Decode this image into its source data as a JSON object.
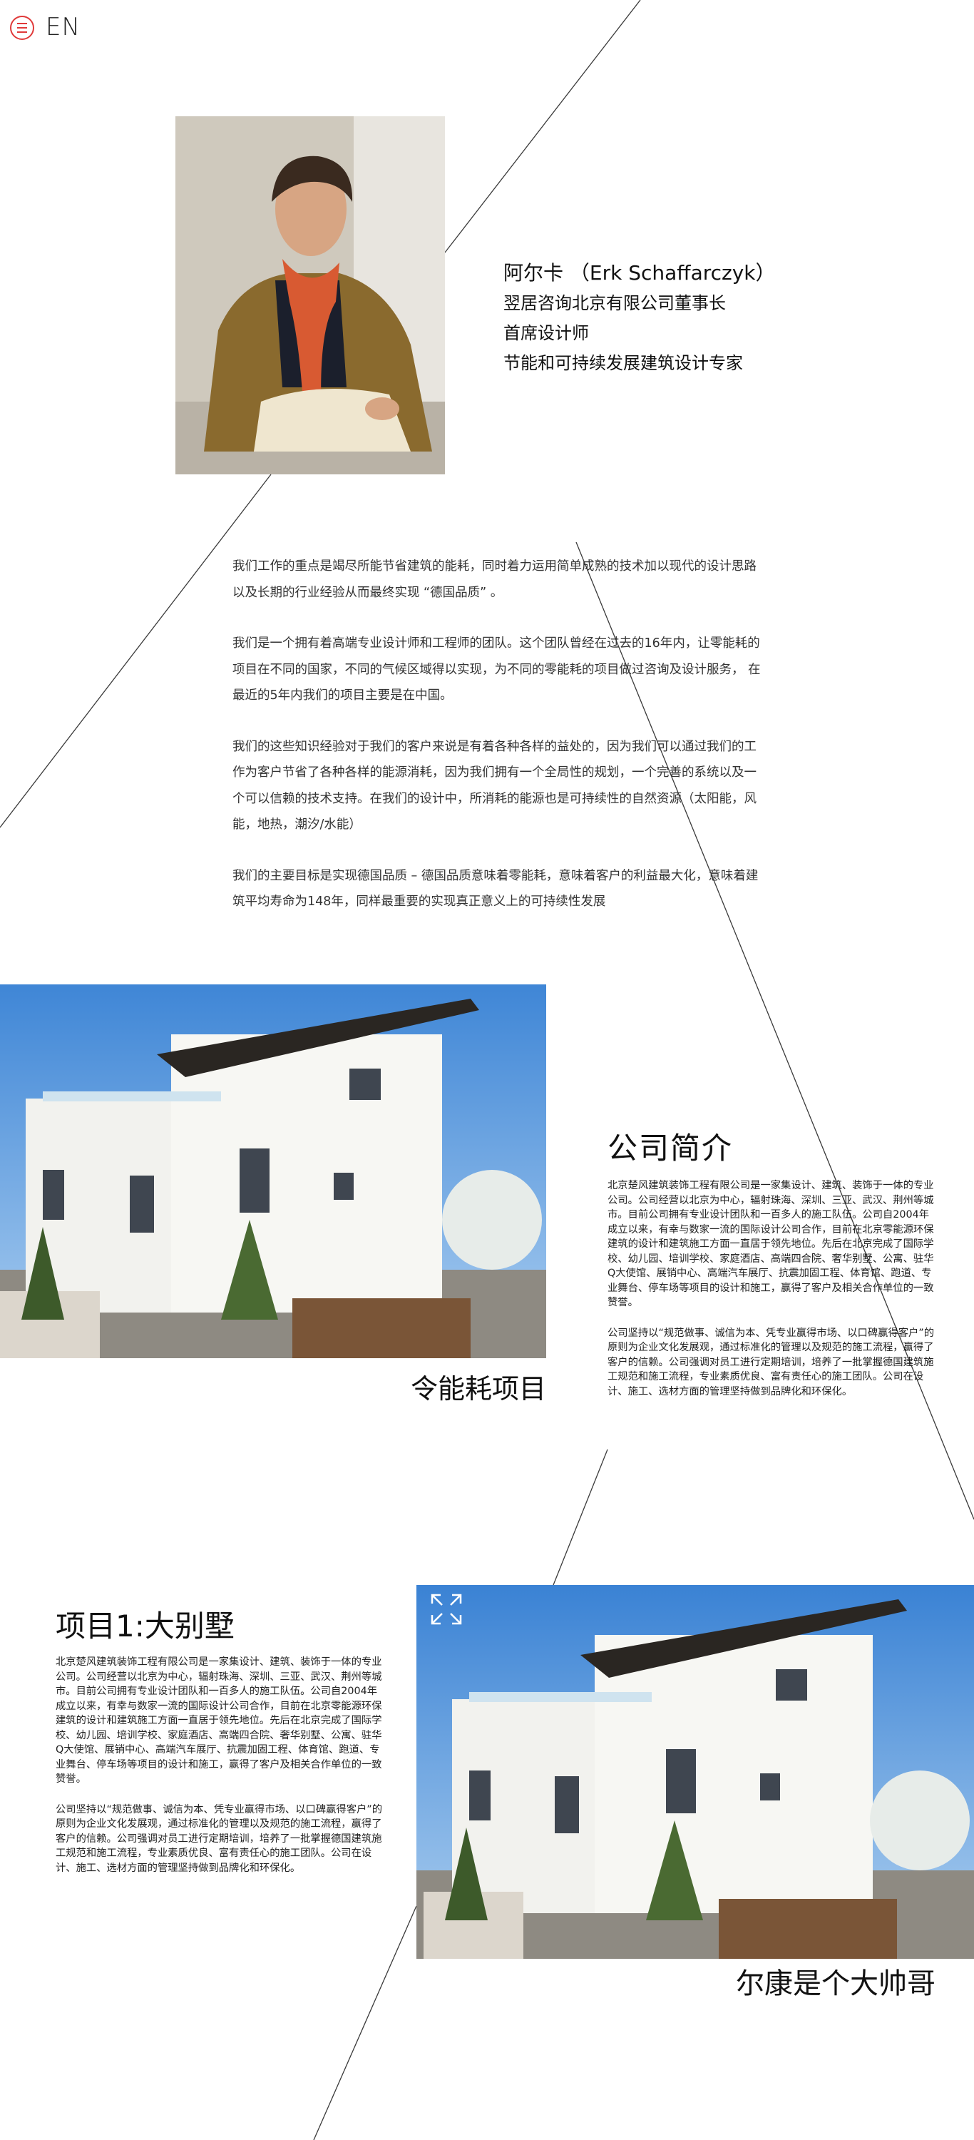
{
  "header": {
    "lang": "EN",
    "menu_icon": "hamburger-menu-icon"
  },
  "bio": {
    "name": "阿尔卡 （Erk Schaffarczyk）",
    "title1": "翌居咨询北京有限公司董事长",
    "title2": "首席设计师",
    "title3": "节能和可持续发展建筑设计专家"
  },
  "intro": {
    "p1": "我们工作的重点是竭尽所能节省建筑的能耗，同时着力运用简单成熟的技术加以现代的设计思路以及长期的行业经验从而最终实现 “德国品质” 。",
    "p2": "我们是一个拥有着高端专业设计师和工程师的团队。这个团队曾经在过去的16年内，让零能耗的项目在不同的国家，不同的气候区域得以实现，为不同的零能耗的项目做过咨询及设计服务， 在最近的5年内我们的项目主要是在中国。",
    "p3": "我们的这些知识经验对于我们的客户来说是有着各种各样的益处的，因为我们可以通过我们的工作为客户节省了各种各样的能源消耗，因为我们拥有一个全局性的规划，一个完善的系统以及一个可以信赖的技术支持。在我们的设计中，所消耗的能源也是可持续性的自然资源（太阳能，风能，地热，潮汐/水能）",
    "p4": "我们的主要目标是实现德国品质 – 德国品质意味着零能耗，意味着客户的利益最大化，意味着建筑平均寿命为148年，同样最重要的实现真正意义上的可持续性发展"
  },
  "section1": {
    "caption": "令能耗项目",
    "heading": "公司简介",
    "p1": "北京楚风建筑装饰工程有限公司是一家集设计、建筑、装饰于一体的专业公司。公司经营以北京为中心，辐射珠海、深圳、三亚、武汉、荆州等城市。目前公司拥有专业设计团队和一百多人的施工队伍。公司自2004年成立以来，有幸与数家一流的国际设计公司合作，目前在北京零能源环保建筑的设计和建筑施工方面一直居于领先地位。先后在北京完成了国际学校、幼儿园、培训学校、家庭酒店、高端四合院、奢华别墅、公寓、驻华Q大使馆、展销中心、高端汽车展厅、抗震加固工程、体育馆、跑道、专业舞台、停车场等项目的设计和施工，赢得了客户及相关合作单位的一致赞誉。",
    "p2": "公司坚持以“规范做事、诚信为本、凭专业赢得市场、以口碑赢得客户”的原则为企业文化发展观，通过标准化的管理以及规范的施工流程，赢得了客户的信赖。公司强调对员工进行定期培训，培养了一批掌握德国建筑施工规范和施工流程，专业素质优良、富有责任心的施工团队。公司在设计、施工、选材方面的管理坚持做到品牌化和环保化。"
  },
  "section2": {
    "heading": "项目1:大别墅",
    "p1": "北京楚风建筑装饰工程有限公司是一家集设计、建筑、装饰于一体的专业公司。公司经营以北京为中心，辐射珠海、深圳、三亚、武汉、荆州等城市。目前公司拥有专业设计团队和一百多人的施工队伍。公司自2004年成立以来，有幸与数家一流的国际设计公司合作，目前在北京零能源环保建筑的设计和建筑施工方面一直居于领先地位。先后在北京完成了国际学校、幼儿园、培训学校、家庭酒店、高端四合院、奢华别墅、公寓、驻华Q大使馆、展销中心、高端汽车展厅、抗震加固工程、体育馆、跑道、专业舞台、停车场等项目的设计和施工，赢得了客户及相关合作单位的一致赞誉。",
    "p2": "公司坚持以“规范做事、诚信为本、凭专业赢得市场、以口碑赢得客户”的原则为企业文化发展观，通过标准化的管理以及规范的施工流程，赢得了客户的信赖。公司强调对员工进行定期培训，培养了一批掌握德国建筑施工规范和施工流程，专业素质优良、富有责任心的施工团队。公司在设计、施工、选材方面的管理坚持做到品牌化和环保化。",
    "caption": "尔康是个大帅哥",
    "expand_icon": "expand-arrows-icon"
  },
  "colors": {
    "accent": "#e03a3a",
    "text": "#222222",
    "line": "#333333"
  }
}
